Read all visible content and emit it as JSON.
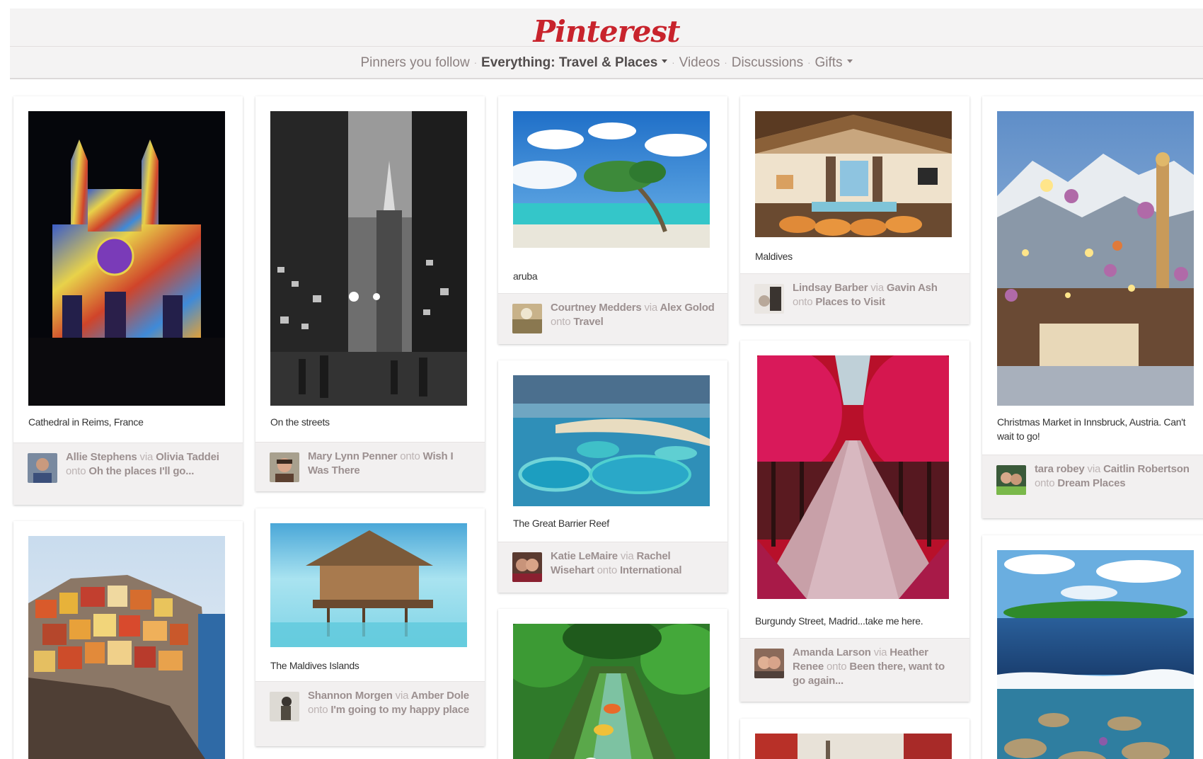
{
  "header": {
    "logo": "Pinterest",
    "nav": [
      {
        "label": "Pinners you follow",
        "active": false,
        "dropdown": false
      },
      {
        "label": "Everything: Travel & Places",
        "active": true,
        "dropdown": true
      },
      {
        "label": "Videos",
        "active": false,
        "dropdown": false
      },
      {
        "label": "Discussions",
        "active": false,
        "dropdown": false
      },
      {
        "label": "Gifts",
        "active": false,
        "dropdown": true
      }
    ],
    "separator": "·"
  },
  "pins": [
    {
      "id": "reims",
      "description": "Cathedral in Reims, France",
      "pinner": "Allie Stephens",
      "via_word": "via",
      "via": "Olivia Taddei",
      "onto_word": "onto",
      "board": "Oh the places I'll go..."
    },
    {
      "id": "streets",
      "description": "On the streets",
      "pinner": "Mary Lynn Penner",
      "onto_word": "onto",
      "board": "Wish I Was There"
    },
    {
      "id": "aruba",
      "description": "aruba",
      "pinner": "Courtney Medders",
      "via_word": "via",
      "via": "Alex Golod",
      "onto_word": "onto",
      "board": "Travel"
    },
    {
      "id": "maldives",
      "description": "Maldives",
      "pinner": "Lindsay Barber",
      "via_word": "via",
      "via": "Gavin Ash",
      "onto_word": "onto",
      "board": "Places to Visit"
    },
    {
      "id": "innsbruck",
      "description": "Christmas Market in Innsbruck, Austria. Can't wait to go!",
      "pinner": "tara robey",
      "via_word": "via",
      "via": "Caitlin Robertson",
      "onto_word": "onto",
      "board": "Dream Places"
    },
    {
      "id": "reef",
      "description": "The Great Barrier Reef",
      "pinner": "Katie LeMaire",
      "via_word": "via",
      "via": "Rachel Wisehart",
      "onto_word": "onto",
      "board": "International"
    },
    {
      "id": "burgundy",
      "description": "Burgundy Street, Madrid...take me here.",
      "pinner": "Amanda Larson",
      "via_word": "via",
      "via": "Heather Renee",
      "onto_word": "onto",
      "board": "Been there, want to go again..."
    },
    {
      "id": "maldives-islands",
      "description": "The Maldives Islands",
      "pinner": "Shannon Morgen",
      "via_word": "via",
      "via": "Amber Dole",
      "onto_word": "onto",
      "board": "I'm going to my happy place"
    },
    {
      "id": "cinque",
      "description": ""
    },
    {
      "id": "river",
      "description": ""
    },
    {
      "id": "island",
      "description": ""
    },
    {
      "id": "city2",
      "description": ""
    }
  ]
}
